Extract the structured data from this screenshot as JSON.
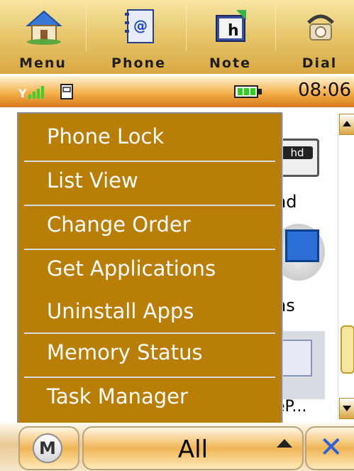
{
  "shortcuts": [
    {
      "label": "Menu",
      "icon": "home-icon"
    },
    {
      "label": "Phone",
      "icon": "address-book-icon"
    },
    {
      "label": "Note",
      "icon": "note-icon"
    },
    {
      "label": "Dial",
      "icon": "telephone-icon"
    }
  ],
  "status": {
    "time": "08:06",
    "signal_icon": "signal-strength-icon",
    "sim_icon": "sim-card-icon",
    "battery_icon": "battery-icon"
  },
  "background": {
    "icon1_tag": "hd",
    "label1": "hd",
    "label2": "ns",
    "label3": "eP..."
  },
  "menu": {
    "items": [
      "Phone Lock",
      "List View",
      "Change Order",
      "Get Applications",
      "Uninstall Apps",
      "Memory Status",
      "Task Manager"
    ]
  },
  "softkeys": {
    "left_icon": "motorola-logo-icon",
    "left_logo_letter": "M",
    "center_label": "All",
    "right_icon": "close-x-icon"
  },
  "colors": {
    "menu_bg": "#b97e06",
    "menu_text": "#ffffff",
    "accent_blue": "#2a62d5"
  }
}
